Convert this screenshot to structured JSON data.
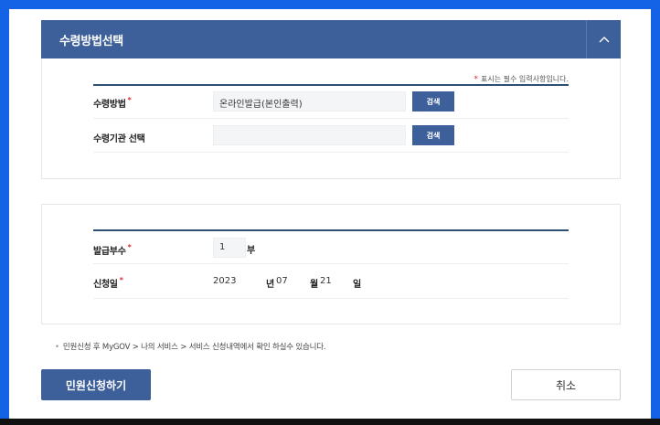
{
  "receipt_panel": {
    "title": "수령방법선택",
    "required_note": "표시는 필수 입력사항입니다.",
    "rows": [
      {
        "label": "수령방법",
        "required": true,
        "value": "온라인발급(본인출력)",
        "button": "검색"
      },
      {
        "label": "수령기관 선택",
        "required": false,
        "value": "",
        "button": "검색"
      }
    ]
  },
  "issue_panel": {
    "copies": {
      "label": "발급부수",
      "value": "1",
      "unit": "부"
    },
    "date": {
      "label": "신청일",
      "year": "2023",
      "year_unit": "년",
      "month": "07",
      "month_unit": "월",
      "day": "21",
      "day_unit": "일"
    }
  },
  "notice": "민원신청 후 MyGOV > 나의 서비스 > 서비스 신청내역에서 확인 하실수 있습니다.",
  "actions": {
    "apply": "민원신청하기",
    "cancel": "취소"
  },
  "colors": {
    "primary": "#3d5f9a",
    "required": "#e0262b",
    "background": "#1463e6"
  },
  "icons": {
    "collapse": "chevron-up-icon"
  }
}
